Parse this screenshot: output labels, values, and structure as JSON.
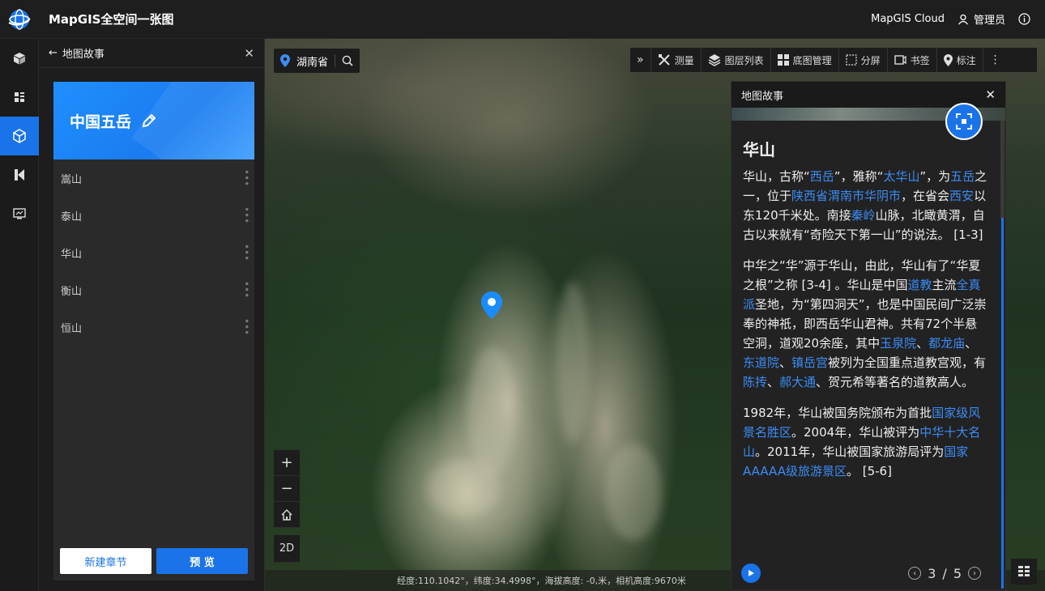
{
  "app": {
    "title": "MapGIS全空间一张图",
    "cloud_label": "MapGIS Cloud",
    "user_label": "管理员"
  },
  "icon_bar": [
    {
      "icon": "cube-icon"
    },
    {
      "icon": "layers-grid-icon"
    },
    {
      "icon": "map-story-icon",
      "active": true
    },
    {
      "icon": "k-icon"
    },
    {
      "icon": "monitor-icon"
    }
  ],
  "story_panel": {
    "header_title": "地图故事",
    "story_title": "中国五岳",
    "chapters": [
      "嵩山",
      "泰山",
      "华山",
      "衡山",
      "恒山"
    ],
    "new_chapter_label": "新建章节",
    "preview_label": "预 览"
  },
  "map": {
    "location": "湖南省",
    "toolbar": [
      {
        "icon": "measure-icon",
        "label": "测量"
      },
      {
        "icon": "layer-list-icon",
        "label": "图层列表"
      },
      {
        "icon": "basemap-icon",
        "label": "底图管理"
      },
      {
        "icon": "split-screen-icon",
        "label": "分屏"
      },
      {
        "icon": "bookmark-icon",
        "label": "书签"
      },
      {
        "icon": "mark-icon",
        "label": "标注"
      }
    ],
    "zoom_in": "+",
    "zoom_out": "−",
    "mode_2d": "2D",
    "status": "经度:110.1042°，纬度:34.4998°，海拔高度: -0,米，相机高度:9670米"
  },
  "story_view": {
    "header_title": "地图故事",
    "chapter_title": "华山",
    "paragraphs": [
      [
        {
          "t": "华山，古称“"
        },
        {
          "t": "西岳",
          "link": true
        },
        {
          "t": "”，雅称“"
        },
        {
          "t": "太华山",
          "link": true
        },
        {
          "t": "”，为"
        },
        {
          "t": "五岳",
          "link": true
        },
        {
          "t": "之一，位于"
        },
        {
          "t": "陕西省渭南市华阴市",
          "link": true
        },
        {
          "t": "，在省会"
        },
        {
          "t": "西安",
          "link": true
        },
        {
          "t": "以东120千米处。南接"
        },
        {
          "t": "秦岭",
          "link": true
        },
        {
          "t": "山脉，北瞰黄渭，自古以来就有“奇险天下第一山”的说法。 [1-3]"
        }
      ],
      [
        {
          "t": "中华之“华”源于华山，由此，华山有了“华夏之根”之称 [3-4] 。华山是中国"
        },
        {
          "t": "道教",
          "link": true
        },
        {
          "t": "主流"
        },
        {
          "t": "全真派",
          "link": true
        },
        {
          "t": "圣地，为“第四洞天”，也是中国民间广泛崇奉的神祇，即西岳华山君神。共有72个半悬空洞，道观20余座，其中"
        },
        {
          "t": "玉泉院",
          "link": true
        },
        {
          "t": "、"
        },
        {
          "t": "都龙庙",
          "link": true
        },
        {
          "t": "、"
        },
        {
          "t": "东道院",
          "link": true
        },
        {
          "t": "、"
        },
        {
          "t": "镇岳宫",
          "link": true
        },
        {
          "t": "被列为全国重点道教宫观，有"
        },
        {
          "t": "陈抟",
          "link": true
        },
        {
          "t": "、"
        },
        {
          "t": "郝大通",
          "link": true
        },
        {
          "t": "、贺元希等著名的道教高人。"
        }
      ],
      [
        {
          "t": "1982年，华山被国务院颁布为首批"
        },
        {
          "t": "国家级风景名胜区",
          "link": true
        },
        {
          "t": "。2004年，华山被评为"
        },
        {
          "t": "中华十大名山",
          "link": true
        },
        {
          "t": "。2011年，华山被国家旅游局评为"
        },
        {
          "t": "国家AAAAA级旅游景区",
          "link": true
        },
        {
          "t": "。 [5-6]"
        }
      ]
    ],
    "page_current": "3",
    "page_sep": "/",
    "page_total": "5"
  },
  "colors": {
    "accent": "#1a73e8",
    "link": "#3b8cf5",
    "background": "#1d1d1d"
  }
}
